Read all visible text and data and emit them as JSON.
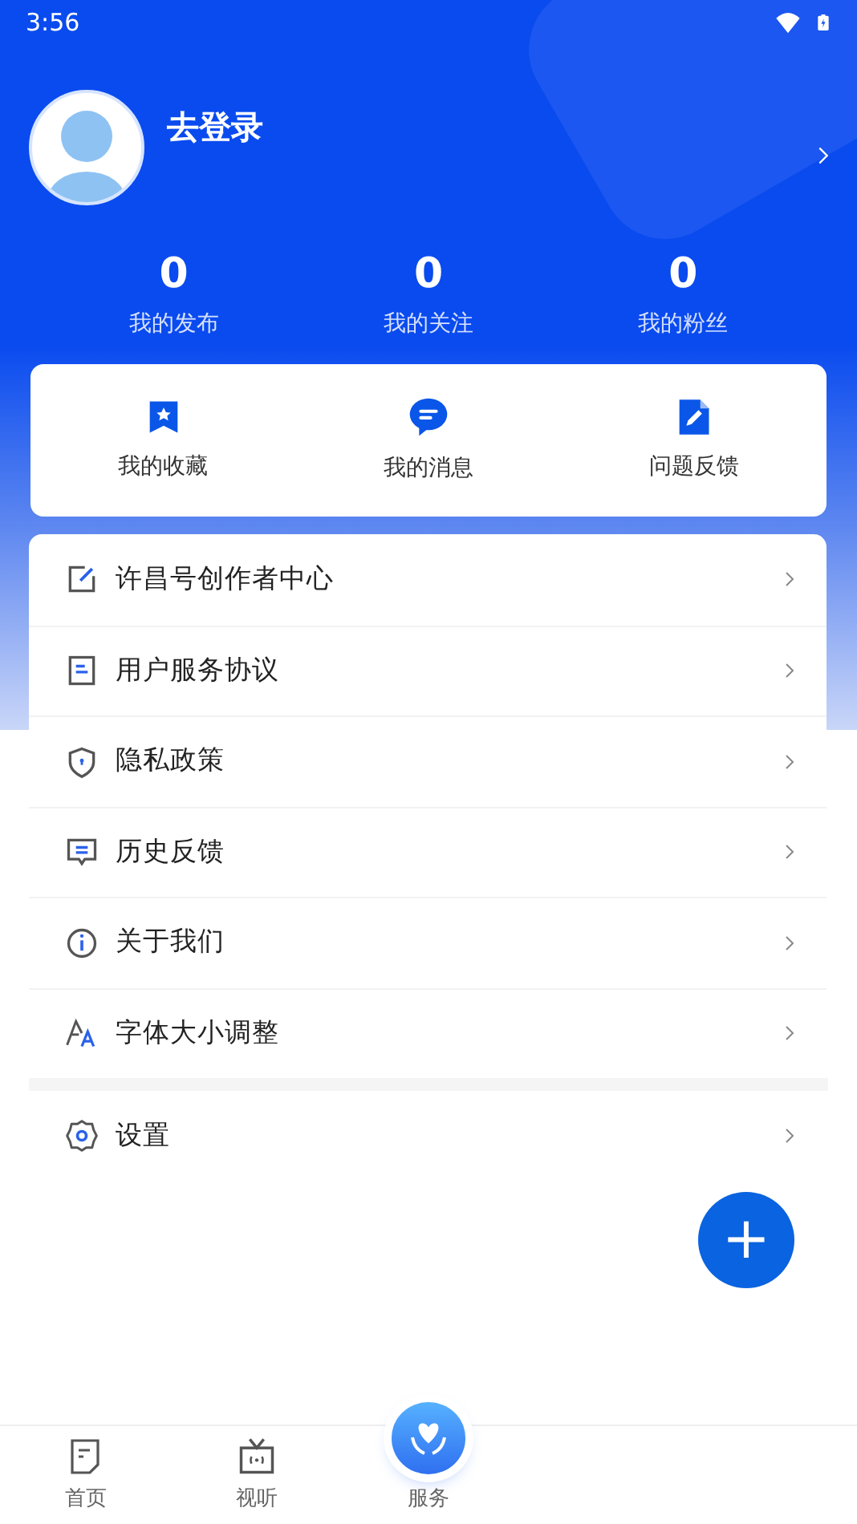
{
  "status_bar": {
    "time": "3:56"
  },
  "profile": {
    "login_label": "去登录"
  },
  "stats": [
    {
      "value": "0",
      "label": "我的发布"
    },
    {
      "value": "0",
      "label": "我的关注"
    },
    {
      "value": "0",
      "label": "我的粉丝"
    }
  ],
  "shortcuts": [
    {
      "kind": "bookmark",
      "label": "我的收藏"
    },
    {
      "kind": "message",
      "label": "我的消息"
    },
    {
      "kind": "feedback",
      "label": "问题反馈"
    }
  ],
  "menu": [
    {
      "kind": "edit",
      "label": "许昌号创作者中心"
    },
    {
      "kind": "document",
      "label": "用户服务协议"
    },
    {
      "kind": "shield",
      "label": "隐私政策"
    },
    {
      "kind": "comment",
      "label": "历史反馈"
    },
    {
      "kind": "info",
      "label": "关于我们"
    },
    {
      "kind": "font",
      "label": "字体大小调整"
    }
  ],
  "settings_menu": [
    {
      "kind": "gear",
      "label": "设置"
    }
  ],
  "fab": {
    "label": "+"
  },
  "bottom_nav": [
    {
      "kind": "home",
      "label": "首页",
      "selected": false
    },
    {
      "kind": "tv",
      "label": "视听",
      "selected": false
    },
    {
      "kind": "center",
      "label": "服务",
      "selected": false
    }
  ]
}
